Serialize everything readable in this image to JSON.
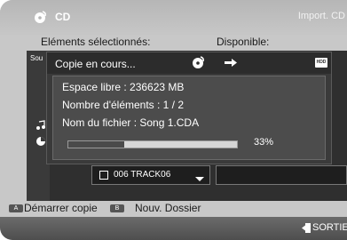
{
  "header": {
    "title": "CD",
    "mode": "Import. CD"
  },
  "columns": {
    "selected": "Eléments sélectionnés:",
    "available": "Disponible:"
  },
  "sidebar": {
    "tag": "Sou"
  },
  "list": {
    "file_label": "006  TRACK06"
  },
  "dialog": {
    "title": "Copie en cours...",
    "free_space": "Espace libre :  236623 MB",
    "item_count": "Nombre d'éléments :  1 / 2",
    "file_name": "Nom du fichier :  Song 1.CDA",
    "progress_percent": 33,
    "progress_label": "33%",
    "dest_icon_label": "HDD"
  },
  "footer": {
    "a_key": "A",
    "a_label": "Démarrer copie",
    "b_key": "B",
    "b_label": "Nouv. Dossier",
    "exit_label": "SORTIE"
  },
  "colors": {
    "panel": "#2f2f2f",
    "dialog": "#3a3a3a",
    "progress_fill": "#4a4a4a"
  }
}
